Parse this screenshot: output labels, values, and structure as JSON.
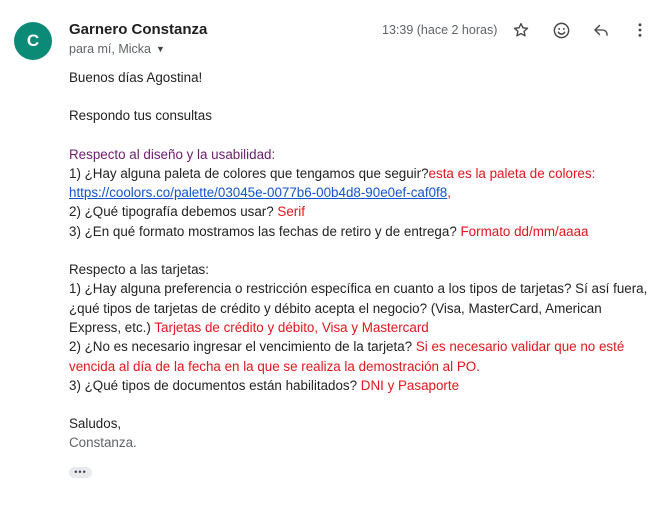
{
  "sender": {
    "initial": "C",
    "name": "Garnero Constanza",
    "recipient": "para mí, Micka",
    "time": "13:39 (hace 2 horas)"
  },
  "actions": {
    "star": "star-icon",
    "emoji": "emoji-icon",
    "reply": "reply-icon",
    "more": "more-vert-icon"
  },
  "colors": {
    "avatar": "#0b8a78",
    "red": "#e0161b",
    "purple": "#6b1e6e",
    "link": "#1155cc"
  },
  "body": {
    "greeting": "Buenos días Agostina!",
    "intro": "Respondo tus consultas",
    "section1_title": "Respecto al diseño y la usabilidad:",
    "q1_prefix": "1) ¿Hay alguna paleta de colores que tengamos que seguir?",
    "q1_answer": "esta es la paleta de colores: ",
    "q1_link": "https://coolors.co/palette/03045e-0077b6-00b4d8-90e0ef-caf0f8",
    "q1_suffix": ",",
    "q2_prefix": "2) ¿Qué tipografía debemos usar? ",
    "q2_answer": "Serif",
    "q3_prefix": "3) ¿En qué formato mostramos las fechas de retiro y de entrega? ",
    "q3_answer": "Formato dd/mm/aaaa",
    "section2_title": "Respecto a las tarjetas:",
    "t1_prefix": "1) ¿Hay alguna preferencia o restricción específica en cuanto a los tipos de tarjetas? Sí así fuera, ¿qué tipos de tarjetas de crédito y débito acepta el negocio? (Visa, MasterCard, American Express, etc.) ",
    "t1_answer": "Tarjetas de crédito y débito,  Visa y Mastercard",
    "t2_prefix": "2) ¿No es necesario ingresar el vencimiento de la tarjeta? ",
    "t2_answer": "Si es necesario validar que no esté vencida al día de la fecha en la que se realiza la demostración al PO.",
    "t3_prefix": "3) ¿Qué tipos de documentos están habilitados? ",
    "t3_answer": "DNI y Pasaporte",
    "closing": "Saludos,",
    "signature": "Constanza.",
    "more": "•••"
  }
}
